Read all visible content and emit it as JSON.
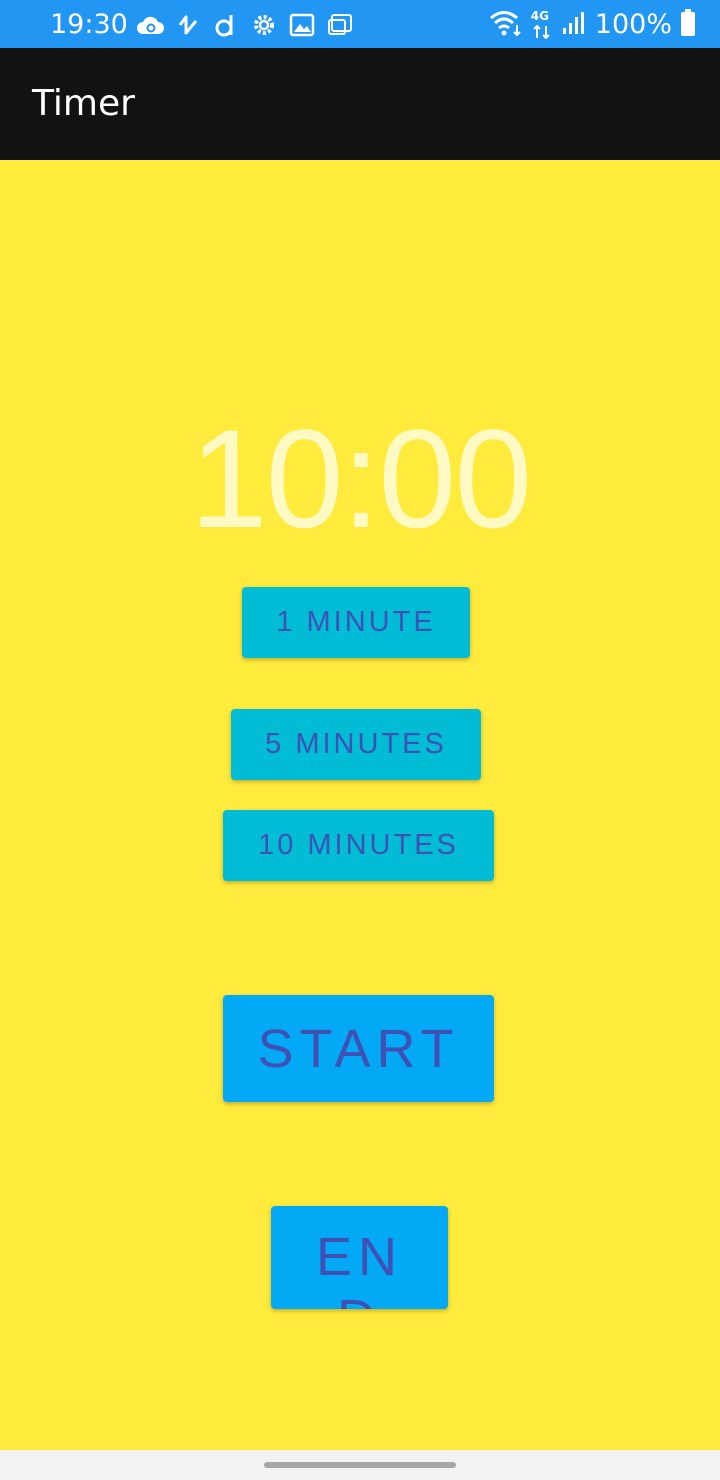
{
  "status_bar": {
    "time": "19:30",
    "notification_icons": [
      "cloud-sync-icon",
      "app-icon",
      "d-app-icon",
      "settings-icon",
      "gallery-icon",
      "screenshot-icon"
    ],
    "network_label": "4G",
    "battery_label": "100%",
    "background_color": "#2196F3"
  },
  "app_bar": {
    "title": "Timer",
    "background_color": "#121212"
  },
  "timer": {
    "display": "10:00",
    "color": "#FFF9C4"
  },
  "presets": {
    "one_minute": "1 MINUTE",
    "five_minutes": "5 MINUTES",
    "ten_minutes": "10 MINUTES",
    "color": "#00BCD4"
  },
  "controls": {
    "start_label": "START",
    "end_label": "END",
    "color": "#03A9F4",
    "text_color": "#3F51B5"
  },
  "background_color": "#FFEB3B"
}
